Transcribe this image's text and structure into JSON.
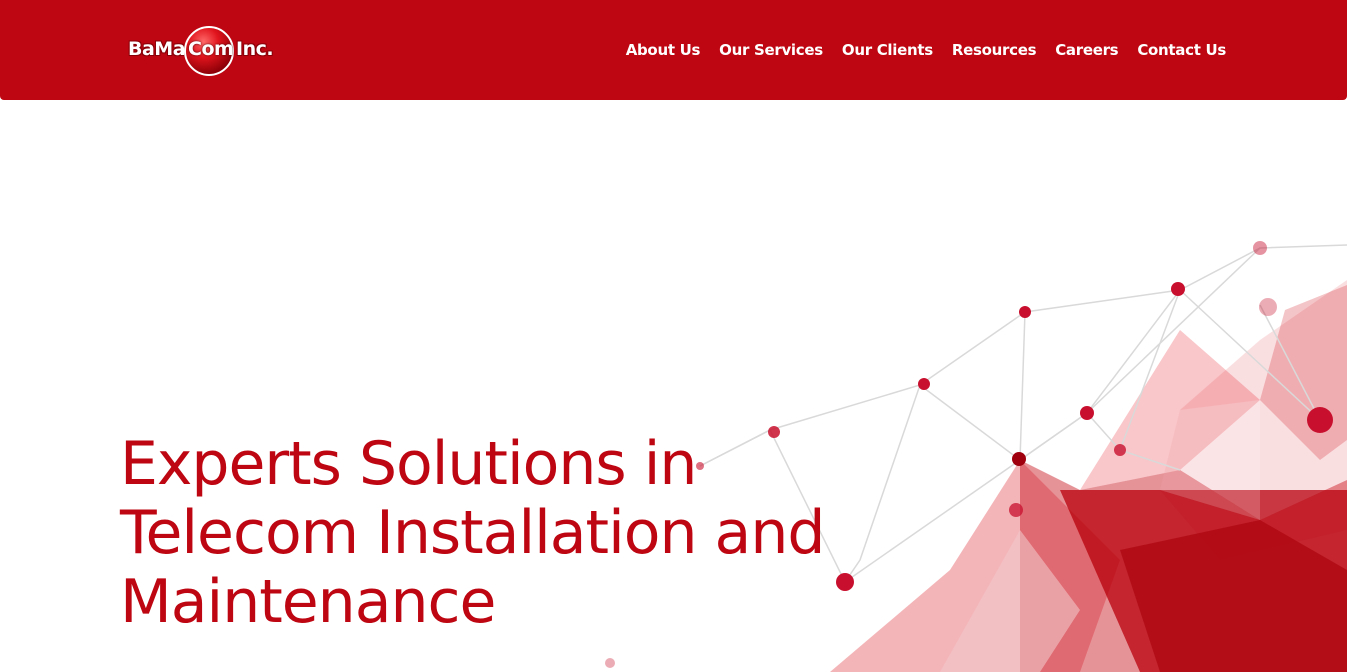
{
  "brand": {
    "logo_left": "BaMa",
    "logo_mid": "Com",
    "logo_right": "Inc.",
    "color": "#bd0611"
  },
  "nav": {
    "items": [
      "About Us",
      "Our Services",
      "Our Clients",
      "Resources",
      "Careers",
      "Contact Us"
    ]
  },
  "hero": {
    "title": "Experts Solutions in Telecom Installation and Maintenance",
    "graphic": "red-polygon-network-graphic"
  }
}
